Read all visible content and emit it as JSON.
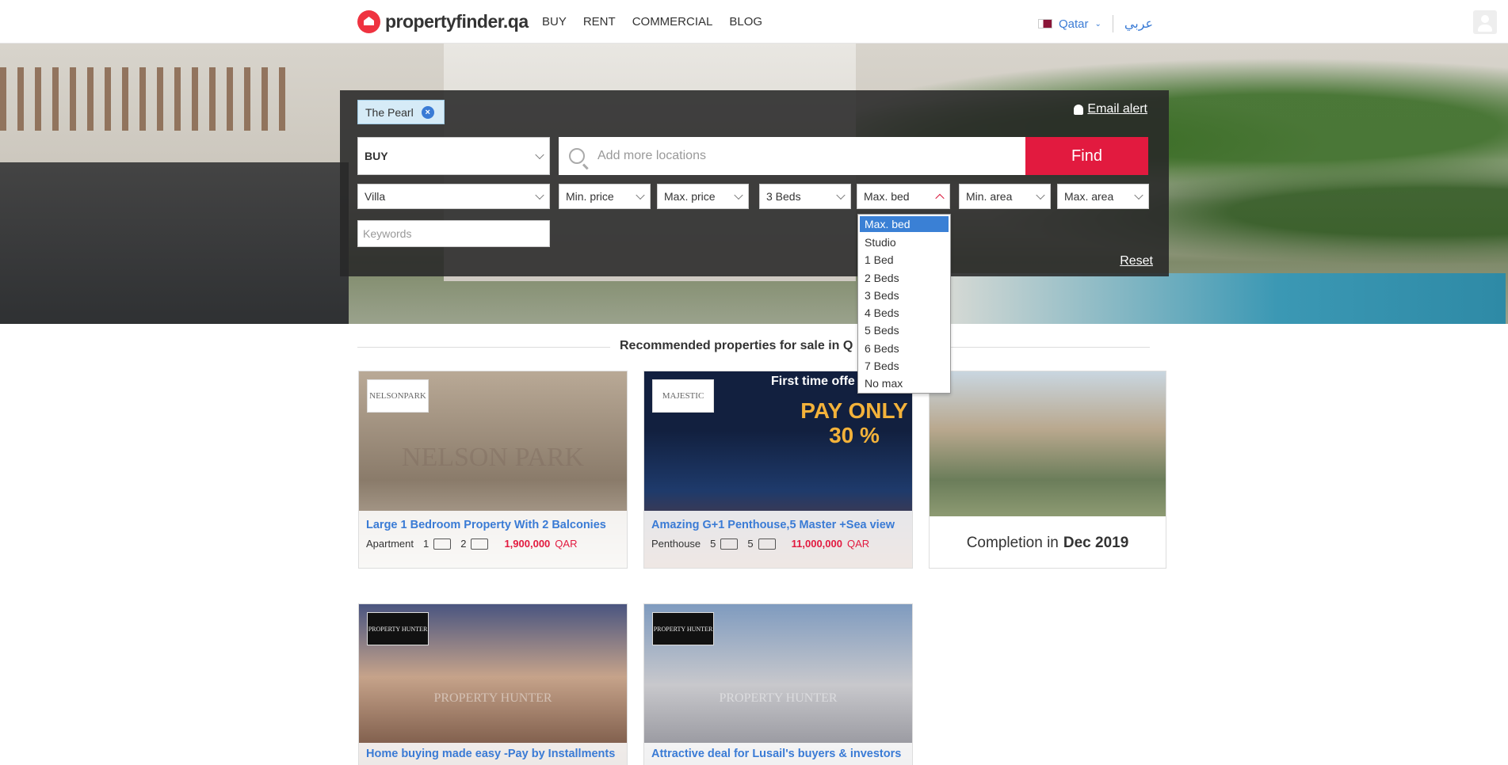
{
  "header": {
    "logo_text": "propertyfinder.qa",
    "nav": [
      "BUY",
      "RENT",
      "COMMERCIAL",
      "BLOG"
    ],
    "country": "Qatar",
    "language": "عربي"
  },
  "search": {
    "selected_location": "The Pearl",
    "email_alert": "Email alert",
    "purpose": "BUY",
    "location_placeholder": "Add more locations",
    "find_label": "Find",
    "property_type": "Villa",
    "min_price": "Min. price",
    "max_price": "Max. price",
    "min_bed": "3 Beds",
    "max_bed": "Max. bed",
    "min_area": "Min. area",
    "max_area": "Max. area",
    "keywords_placeholder": "Keywords",
    "reset_label": "Reset",
    "max_bed_options": [
      "Max. bed",
      "Studio",
      "1 Bed",
      "2 Beds",
      "3 Beds",
      "4 Beds",
      "5 Beds",
      "6 Beds",
      "7 Beds",
      "No max"
    ],
    "max_bed_highlighted": "Max. bed"
  },
  "recommended": {
    "heading": "Recommended properties for sale in Q",
    "cards": [
      {
        "badge": "NELSONPARK",
        "watermark": "NELSON PARK",
        "title": "Large 1 Bedroom Property With 2 Balconies",
        "type": "Apartment",
        "beds": "1",
        "baths": "2",
        "price": "1,900,000",
        "currency": "QAR"
      },
      {
        "badge": "MAJESTIC",
        "offer": "First time offe",
        "promo": "PAY ONLY 30 %",
        "title": "Amazing G+1 Penthouse,5 Master +Sea view",
        "type": "Penthouse",
        "beds": "5",
        "baths": "5",
        "price": "11,000,000",
        "currency": "QAR"
      },
      {
        "completion_prefix": "Completion in",
        "completion_date": "Dec 2019"
      },
      {
        "badge": "PROPERTY HUNTER",
        "watermark": "PROPERTY HUNTER",
        "title": "Home buying made easy -Pay by Installments"
      },
      {
        "badge": "PROPERTY HUNTER",
        "watermark": "PROPERTY HUNTER",
        "title": "Attractive deal for Lusail's buyers & investors"
      }
    ]
  },
  "colors": {
    "brand_red": "#e21a3f",
    "link_blue": "#3a7bd5",
    "panel_bg": "#282828"
  }
}
